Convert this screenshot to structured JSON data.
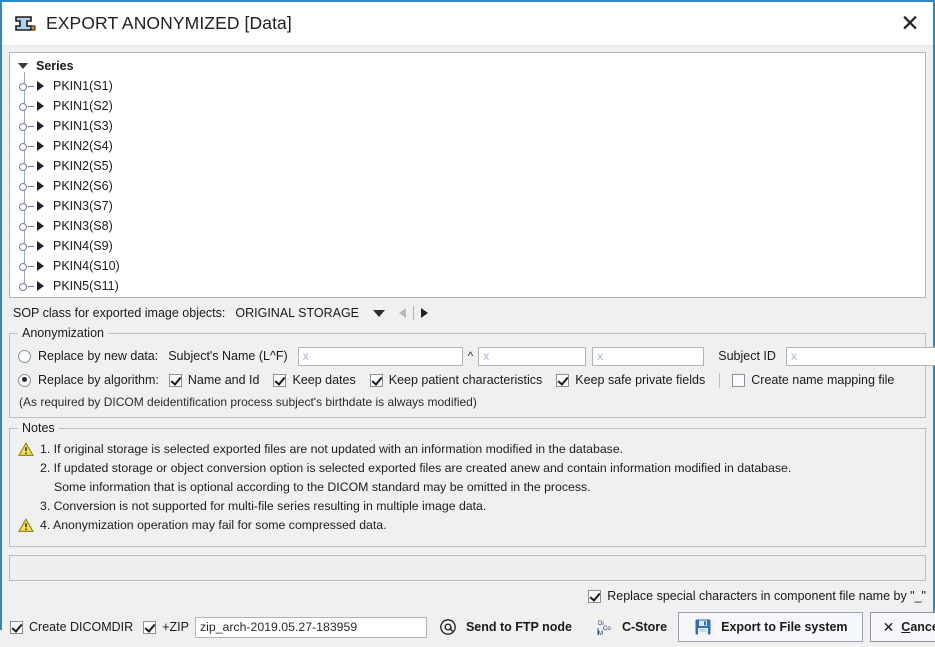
{
  "window": {
    "title": "EXPORT ANONYMIZED [Data]",
    "title_icon": "anonymize-icon",
    "close_icon": "close-icon",
    "accent_color": "#2e87c8"
  },
  "tree": {
    "root_label": "Series",
    "items": [
      {
        "label": "PKIN1(S1)"
      },
      {
        "label": "PKIN1(S2)"
      },
      {
        "label": "PKIN1(S3)"
      },
      {
        "label": "PKIN2(S4)"
      },
      {
        "label": "PKIN2(S5)"
      },
      {
        "label": "PKIN2(S6)"
      },
      {
        "label": "PKIN3(S7)"
      },
      {
        "label": "PKIN3(S8)"
      },
      {
        "label": "PKIN4(S9)"
      },
      {
        "label": "PKIN4(S10)"
      },
      {
        "label": "PKIN5(S11)"
      }
    ]
  },
  "sop": {
    "label": "SOP class for exported image objects:",
    "value": "ORIGINAL STORAGE",
    "dropdown_icon": "chevron-down-icon",
    "prev_icon": "arrow-left-icon",
    "next_icon": "arrow-right-icon"
  },
  "anonymization": {
    "group_title": "Anonymization",
    "replace_new_label": "Replace by new data:",
    "replace_new_selected": false,
    "subject_name_label": "Subject's Name (L^F)",
    "subject_name_last": "",
    "subject_name_last_placeholder": "x",
    "name_separator": "^",
    "subject_name_first": "",
    "subject_name_first_placeholder": "x",
    "subject_name_middle": "",
    "subject_name_middle_placeholder": "x",
    "subject_id_label": "Subject ID",
    "subject_id": "",
    "subject_id_placeholder": "x",
    "replace_algo_label": "Replace by algorithm:",
    "replace_algo_selected": true,
    "options": [
      {
        "label": "Name and Id",
        "checked": true
      },
      {
        "label": "Keep dates",
        "checked": true
      },
      {
        "label": "Keep patient characteristics",
        "checked": true
      },
      {
        "label": "Keep safe private fields",
        "checked": true
      },
      {
        "label": "Create name mapping file",
        "checked": false
      }
    ],
    "footnote": "(As required by DICOM deidentification process subject's birthdate is always modified)"
  },
  "notes": {
    "group_title": "Notes",
    "items": [
      {
        "warn": true,
        "text": "1. If original storage is selected exported files are not updated with an information modified in the database.",
        "sub": ""
      },
      {
        "warn": false,
        "text": "2. If updated storage or object conversion option is selected exported files are created anew and contain information modified in database.",
        "sub": "Some information that is optional according to the DICOM standard may be omitted in the process."
      },
      {
        "warn": false,
        "text": "3. Conversion is not supported for multi-file series resulting in multiple image data.",
        "sub": ""
      },
      {
        "warn": true,
        "text": "4. Anonymization operation may fail for some compressed data.",
        "sub": ""
      }
    ]
  },
  "special_chars": {
    "label": "Replace special characters in component file name by \"_\"",
    "checked": true
  },
  "bottom": {
    "create_dicomdir_label": "Create DICOMDIR",
    "create_dicomdir_checked": true,
    "zip_label": "+ZIP",
    "zip_checked": true,
    "zip_filename": "zip_arch-2019.05.27-183959",
    "ftp_label": "Send to FTP node",
    "ftp_icon": "at-sign-icon",
    "cstore_label": "C-Store",
    "cstore_icon": "dicom-icon",
    "export_label": "Export to File system",
    "export_icon": "floppy-disk-icon",
    "cancel_label": "Cancel",
    "cancel_icon": "close-icon"
  }
}
